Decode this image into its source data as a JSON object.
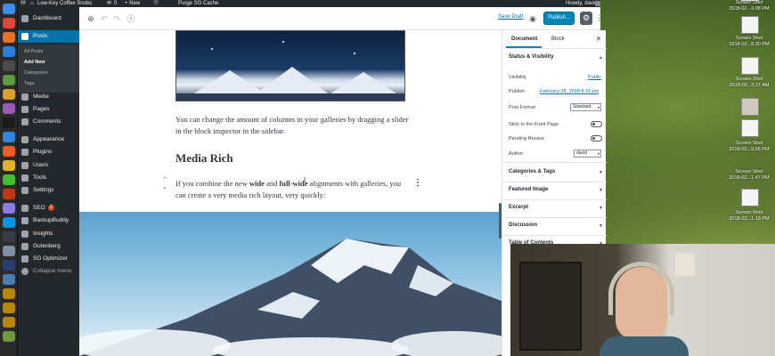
{
  "admin_bar": {
    "site_name": "Low-Key Coffee Snobs",
    "comments_count": "0",
    "new_label": "+ New",
    "cache_label": "Purge SG Cache",
    "howdy": "Howdy, david"
  },
  "sidebar": {
    "items": [
      {
        "label": "Dashboard"
      },
      {
        "label": "Posts"
      },
      {
        "label": "Media"
      },
      {
        "label": "Pages"
      },
      {
        "label": "Comments"
      },
      {
        "label": "Appearance"
      },
      {
        "label": "Plugins"
      },
      {
        "label": "Users"
      },
      {
        "label": "Tools"
      },
      {
        "label": "Settings"
      },
      {
        "label": "SEO"
      },
      {
        "label": "BackupBuddy"
      },
      {
        "label": "Insights"
      },
      {
        "label": "Gutenberg"
      },
      {
        "label": "SG Optimizer"
      },
      {
        "label": "Collapse menu"
      }
    ],
    "seo_badge": "2",
    "posts_submenu": [
      "All Posts",
      "Add New",
      "Categories",
      "Tags"
    ]
  },
  "toolbar": {
    "save_draft": "Save Draft",
    "publish": "Publish..."
  },
  "content": {
    "paragraph_1": "You can change the amount of columns in your galleries by dragging a slider in the block inspector in the sidebar.",
    "heading": "Media Rich",
    "p2_start": "If you combine the new ",
    "p2_wide": "wide",
    "p2_and": " and ",
    "p2_fullwide": "full-wide",
    "p2_end": " alignments with galleries, you can create a very media rich layout, very quickly:"
  },
  "settings_panel": {
    "tab_document": "Document",
    "tab_block": "Block",
    "status_visibility": "Status & Visibility",
    "visibility_label": "Visibility",
    "visibility_value": "Public",
    "publish_label": "Publish",
    "publish_value": "February 28, 2018 8:15 pm",
    "post_format_label": "Post Format",
    "post_format_value": "Standard",
    "sticky_label": "Stick to the Front Page",
    "pending_label": "Pending Review",
    "author_label": "Author",
    "author_value": "david",
    "sections": [
      "Categories & Tags",
      "Featured Image",
      "Excerpt",
      "Discussion",
      "Table of Contents"
    ]
  },
  "desktop_icons": [
    {
      "line1": "Screen Shot",
      "line2": "2018-02...4.08 PM"
    },
    {
      "line1": "Screen Shot",
      "line2": "2018-02...9.30 PM"
    },
    {
      "line1": "Screen Shot",
      "line2": "2018-02...3.27 AM"
    },
    {
      "line1": "Screen Shot",
      "line2": "2018-02...9.56 PM"
    },
    {
      "line1": "Screen Shot",
      "line2": "2018-02...1.47 PM"
    },
    {
      "line1": "Screen Shot",
      "line2": "2018-02...1.18 PM"
    }
  ],
  "colors": {
    "wp_admin_dark": "#23282d",
    "wp_blue": "#0073aa",
    "publish_blue": "#0085ba"
  }
}
